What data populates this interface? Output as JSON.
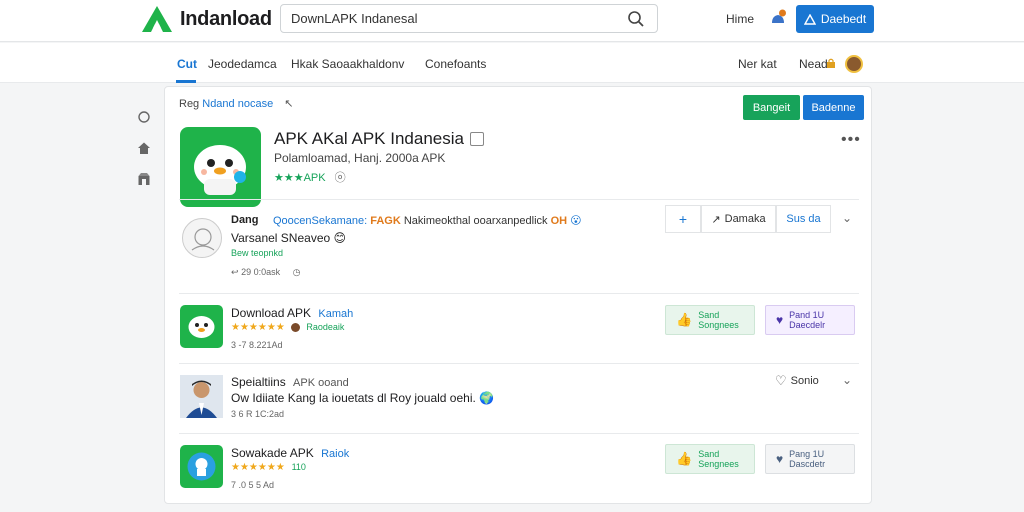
{
  "header": {
    "brand": "Indanload",
    "search_value": "DownLAPK Indanesal",
    "home_label": "Hime",
    "primary_button": "Daebedt"
  },
  "subnav": {
    "items": [
      "Cut",
      "Jeodedamca",
      "Hkak Saoaakhaldonv",
      "Conefoants"
    ],
    "right_items": [
      "Ner kat",
      "Nead"
    ]
  },
  "panel": {
    "breadcrumb_prefix": "Reg",
    "breadcrumb_link": "Ndand nocase",
    "green_button": "Bangeit",
    "blue_button": "Badenne",
    "app": {
      "title": "APK AKal APK Indanesia",
      "subtitle": "Polamloamad, Hanj. 2000a APK",
      "rating": "★★★APK"
    },
    "comment": {
      "name": "Dang",
      "line1_link": "QoocenSekamane:",
      "line1_warn": "FAGK",
      "line1_text": "Nakimeokthal ooarxanpedlick",
      "line1_badge": "OH",
      "line2": "Varsanel SNeaveo",
      "line3": "Bew teopnkd",
      "meta": "29 0:0ask",
      "actions": [
        "+",
        "Damaka",
        "Sus da"
      ]
    },
    "rows": [
      {
        "title": "Download APK",
        "tag": "Kamah",
        "stars": "★★★★★★",
        "sub": "Raodeaik",
        "meta": "3 -7 8.221Ad",
        "pill1": [
          "Sand",
          "Songnees"
        ],
        "pill2": [
          "Pand 1U",
          "Daecdelr"
        ]
      },
      {
        "title": "Speialtiins",
        "tag": "APK ooand",
        "line": "Ow Idiiate Kang la iouetats dl Roy jouald oehi.",
        "meta": "3 6 R 1C:2ad",
        "like": "Sonio"
      },
      {
        "title": "Sowakade APK",
        "tag": "Raiok",
        "stars": "★★★★★★",
        "sub": "110",
        "meta": "7 .0 5 5 Ad",
        "pill1": [
          "Sand",
          "Sengnees"
        ],
        "pill2": [
          "Pang 1U",
          "Dascdetr"
        ]
      }
    ]
  },
  "colors": {
    "accent": "#1976d2",
    "green": "#17a35a",
    "brand_green": "#1fb34a",
    "star": "#f0a81c"
  }
}
